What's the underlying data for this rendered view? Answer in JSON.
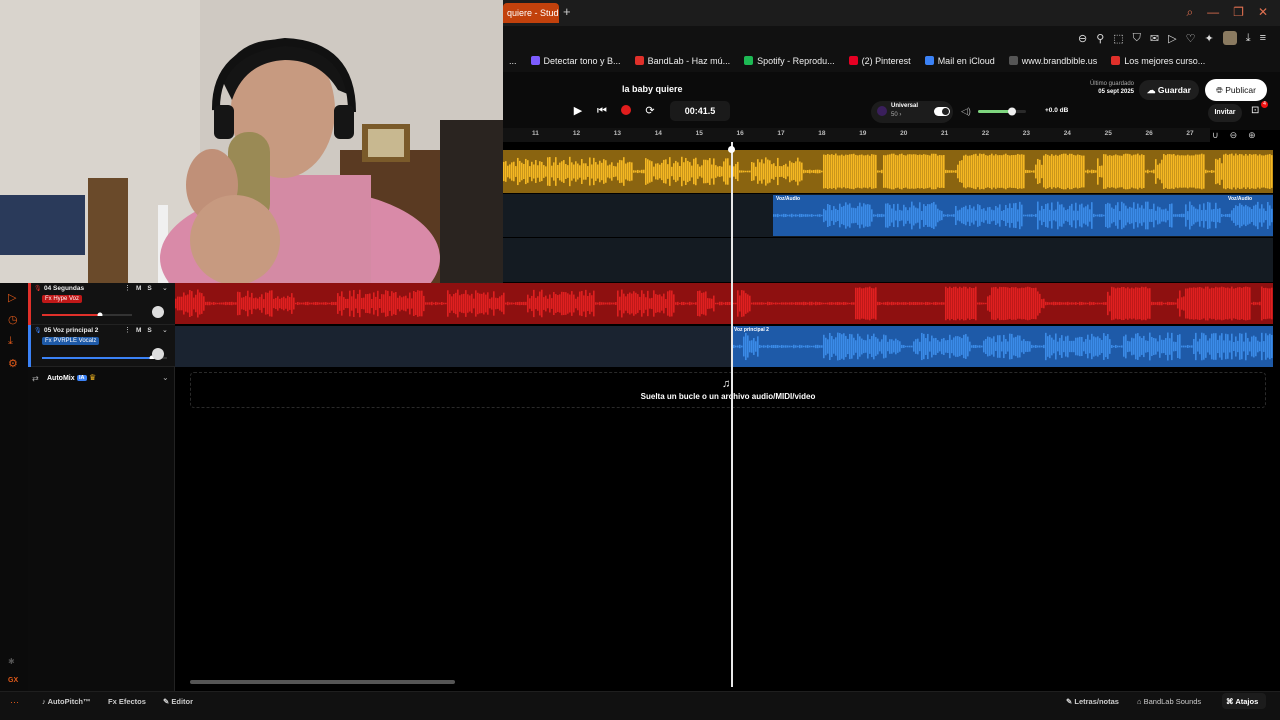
{
  "browser": {
    "active_tab": "quiere - Studio",
    "new_tab": "+",
    "bookmarks": [
      {
        "label": "...",
        "color": "#888888"
      },
      {
        "label": "Detectar tono y B...",
        "color": "#7c5cff"
      },
      {
        "label": "BandLab - Haz mú...",
        "color": "#e0302a"
      },
      {
        "label": "Spotify - Reprodu...",
        "color": "#1db954"
      },
      {
        "label": "(2) Pinterest",
        "color": "#e60023"
      },
      {
        "label": "Mail en iCloud",
        "color": "#3b82f6"
      },
      {
        "label": "www.brandbible.us",
        "color": "#555555"
      },
      {
        "label": "Los mejores curso...",
        "color": "#e0302a"
      }
    ]
  },
  "header": {
    "project_title": "la baby quiere",
    "time": "00:41.5",
    "key": "Universal",
    "bpm": "50 ›",
    "volume_db": "+0.0 dB",
    "saved_label": "Último guardado",
    "saved_date": "05 sept 2025",
    "save_label": "Guardar",
    "publish_label": "Publicar",
    "invite_label": "Invitar",
    "badge_count": "4"
  },
  "ruler": {
    "ticks": [
      "11",
      "12",
      "13",
      "14",
      "15",
      "16",
      "17",
      "18",
      "19",
      "20",
      "21",
      "22",
      "23",
      "24",
      "25",
      "26",
      "27"
    ]
  },
  "tracks": [
    {
      "name": "04 Segundas",
      "fx": "Fx Hype Voz",
      "color": "#e0302a",
      "mute": "M",
      "solo": "S"
    },
    {
      "name": "05 Voz principal 2",
      "fx": "Fx PVRPLE Vocalz",
      "color": "#3b82f6",
      "mute": "M",
      "solo": "S",
      "clip_label": "Voz principal 2"
    }
  ],
  "clips": {
    "voz_audio_1": "Voz/Audio",
    "voz_audio_2": "Voz/Audio"
  },
  "automix": {
    "label": "AutoMix",
    "badge": "IA"
  },
  "drop_zone_text": "Suelta un bucle o un archivo audio/MIDI/video",
  "bottom_bar": {
    "autopitch": "AutoPitch™",
    "effects": "Efectos",
    "editor": "Editor",
    "lyrics": "Letras/notas",
    "sounds": "BandLab Sounds",
    "shortcuts": "Atajos"
  },
  "rail": {
    "bottom_label": "GX"
  },
  "colors": {
    "accent": "#e05a1a",
    "yellow_wave": "#f5b823",
    "blue_wave": "#3b8be8",
    "red_wave": "#e02020"
  }
}
